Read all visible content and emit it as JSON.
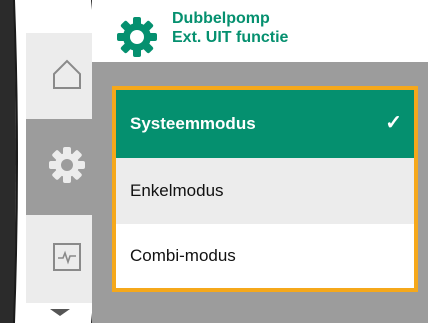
{
  "header": {
    "title_line1": "Dubbelpomp",
    "title_line2": "Ext. UIT functie",
    "icon": "gear-icon"
  },
  "sidebar": {
    "items": [
      {
        "icon": "home-icon",
        "active": false
      },
      {
        "icon": "gear-icon",
        "active": true
      },
      {
        "icon": "diagnostics-icon",
        "active": false
      }
    ],
    "scroll_icon": "chevron-down-icon"
  },
  "options": {
    "items": [
      {
        "label": "Systeemmodus",
        "selected": true,
        "highlighted": true
      },
      {
        "label": "Enkelmodus",
        "selected": false
      },
      {
        "label": "Combi-modus",
        "selected": false
      }
    ],
    "check_glyph": "✓"
  },
  "colors": {
    "accent_green": "#05906f",
    "focus_orange": "#f5a81b",
    "panel_gray": "#9c9c9c",
    "light_gray": "#ececec"
  }
}
